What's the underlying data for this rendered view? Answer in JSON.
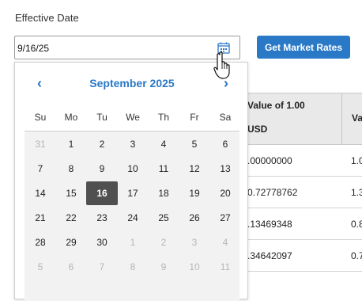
{
  "form": {
    "effective_date_label": "Effective Date",
    "date_value": "9/16/25",
    "get_rates_label": "Get Market Rates"
  },
  "table": {
    "header_col1_line1": "Value of 1.00",
    "header_col1_line2": "USD",
    "header_col2": "Va",
    "rows": [
      {
        "c1": ".00000000",
        "c2": "1.0"
      },
      {
        "c1": "0.72778762",
        "c2": "1.3"
      },
      {
        "c1": ".13469348",
        "c2": "0.8"
      },
      {
        "c1": ".34642097",
        "c2": "0.7"
      }
    ]
  },
  "calendar": {
    "month_label": "September 2025",
    "prev_glyph": "‹",
    "next_glyph": "›",
    "weekdays": [
      "Su",
      "Mo",
      "Tu",
      "We",
      "Th",
      "Fr",
      "Sa"
    ],
    "weeks": [
      [
        {
          "d": "31",
          "m": true
        },
        {
          "d": "1"
        },
        {
          "d": "2"
        },
        {
          "d": "3"
        },
        {
          "d": "4"
        },
        {
          "d": "5"
        },
        {
          "d": "6"
        }
      ],
      [
        {
          "d": "7"
        },
        {
          "d": "8"
        },
        {
          "d": "9"
        },
        {
          "d": "10"
        },
        {
          "d": "11"
        },
        {
          "d": "12"
        },
        {
          "d": "13"
        }
      ],
      [
        {
          "d": "14"
        },
        {
          "d": "15"
        },
        {
          "d": "16",
          "s": true
        },
        {
          "d": "17"
        },
        {
          "d": "18"
        },
        {
          "d": "19"
        },
        {
          "d": "20"
        }
      ],
      [
        {
          "d": "21"
        },
        {
          "d": "22"
        },
        {
          "d": "23"
        },
        {
          "d": "24"
        },
        {
          "d": "25"
        },
        {
          "d": "26"
        },
        {
          "d": "27"
        }
      ],
      [
        {
          "d": "28"
        },
        {
          "d": "29"
        },
        {
          "d": "30"
        },
        {
          "d": "1",
          "m": true
        },
        {
          "d": "2",
          "m": true
        },
        {
          "d": "3",
          "m": true
        },
        {
          "d": "4",
          "m": true
        }
      ],
      [
        {
          "d": "5",
          "m": true
        },
        {
          "d": "6",
          "m": true
        },
        {
          "d": "7",
          "m": true
        },
        {
          "d": "8",
          "m": true
        },
        {
          "d": "9",
          "m": true
        },
        {
          "d": "10",
          "m": true
        },
        {
          "d": "11",
          "m": true
        }
      ]
    ]
  },
  "colors": {
    "accent": "#2a78c6",
    "button_bg": "#2979c7",
    "selected_day_bg": "#505050"
  },
  "icons": {
    "date_picker": "calendar-icon",
    "cursor": "hand-pointer-icon"
  }
}
